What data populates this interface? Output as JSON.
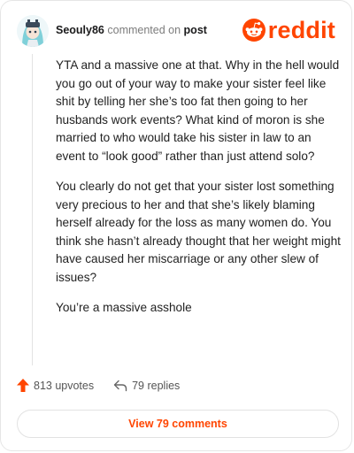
{
  "comment": {
    "username": "Seouly86",
    "commented_text": "commented on",
    "post_link": "post",
    "paragraphs": [
      "YTA and a massive one at that. Why in the hell would you go out of your way to make your sister feel like shit by telling her she’s too fat then going to her husbands work events? What kind of moron is she married to who would take his sister in law to an event to “look good” rather than just attend solo?",
      "You clearly do not get that your sister lost something very precious to her and that she’s likely blaming herself already for the loss as many women do. You think she hasn’t already thought that her weight might have caused her miscarriage or any other slew of issues?",
      "You’re a massive asshole"
    ]
  },
  "brand": {
    "name": "reddit",
    "color": "#ff4500",
    "icon": "reddit-snoo-icon"
  },
  "actions": {
    "upvotes": "813 upvotes",
    "replies": "79 replies"
  },
  "view_comments_label": "View 79 comments",
  "colors": {
    "accent": "#ff4500",
    "avatar_hair": "#7fd0d9"
  }
}
